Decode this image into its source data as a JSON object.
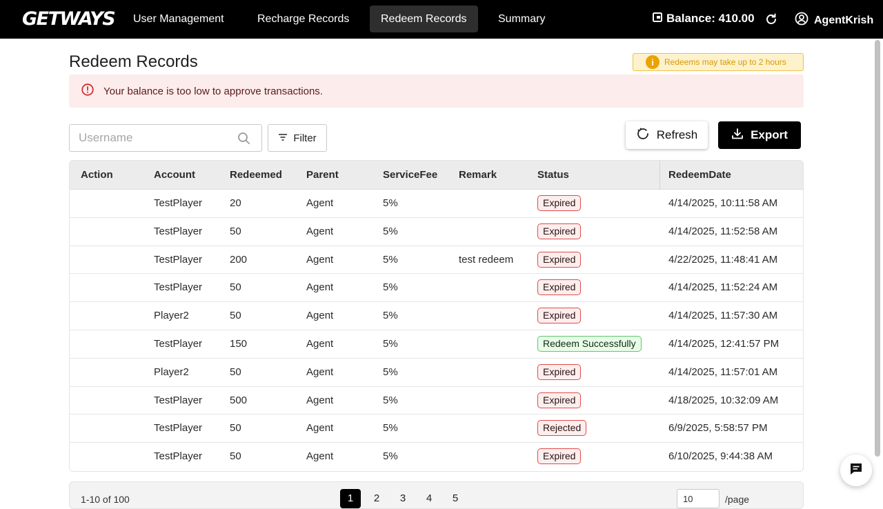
{
  "nav": {
    "logo": "GETWAYS",
    "items": [
      {
        "label": "User Management"
      },
      {
        "label": "Recharge Records"
      },
      {
        "label": "Redeem Records",
        "active": true
      },
      {
        "label": "Summary"
      }
    ],
    "balance": "Balance: 410.00",
    "username": "AgentKrish"
  },
  "page": {
    "title": "Redeem Records",
    "notice": "Redeems may take up to 2 hours",
    "notice_icon": "i",
    "alert": "Your balance is too low to approve transactions."
  },
  "toolbar": {
    "search_placeholder": "Username",
    "filter_label": "Filter",
    "refresh_label": "Refresh",
    "export_label": "Export"
  },
  "table": {
    "headers": {
      "action": "Action",
      "account": "Account",
      "redeemed": "Redeemed",
      "parent": "Parent",
      "servicefee": "ServiceFee",
      "remark": "Remark",
      "status": "Status",
      "redeemdate": "RedeemDate"
    },
    "rows": [
      {
        "account": "TestPlayer",
        "redeemed": "20",
        "parent": "Agent",
        "fee": "5%",
        "remark": "",
        "status": "Expired",
        "status_type": "red",
        "date": "4/14/2025, 10:11:58 AM"
      },
      {
        "account": "TestPlayer",
        "redeemed": "50",
        "parent": "Agent",
        "fee": "5%",
        "remark": "",
        "status": "Expired",
        "status_type": "red",
        "date": "4/14/2025, 11:52:58 AM"
      },
      {
        "account": "TestPlayer",
        "redeemed": "200",
        "parent": "Agent",
        "fee": "5%",
        "remark": "test redeem",
        "status": "Expired",
        "status_type": "red",
        "date": "4/22/2025, 11:48:41 AM"
      },
      {
        "account": "TestPlayer",
        "redeemed": "50",
        "parent": "Agent",
        "fee": "5%",
        "remark": "",
        "status": "Expired",
        "status_type": "red",
        "date": "4/14/2025, 11:52:24 AM"
      },
      {
        "account": "Player2",
        "redeemed": "50",
        "parent": "Agent",
        "fee": "5%",
        "remark": "",
        "status": "Expired",
        "status_type": "red",
        "date": "4/14/2025, 11:57:30 AM"
      },
      {
        "account": "TestPlayer",
        "redeemed": "150",
        "parent": "Agent",
        "fee": "5%",
        "remark": "",
        "status": "Redeem Successfully",
        "status_type": "green",
        "date": "4/14/2025, 12:41:57 PM"
      },
      {
        "account": "Player2",
        "redeemed": "50",
        "parent": "Agent",
        "fee": "5%",
        "remark": "",
        "status": "Expired",
        "status_type": "red",
        "date": "4/14/2025, 11:57:01 AM"
      },
      {
        "account": "TestPlayer",
        "redeemed": "500",
        "parent": "Agent",
        "fee": "5%",
        "remark": "",
        "status": "Expired",
        "status_type": "red",
        "date": "4/18/2025, 10:32:09 AM"
      },
      {
        "account": "TestPlayer",
        "redeemed": "50",
        "parent": "Agent",
        "fee": "5%",
        "remark": "",
        "status": "Rejected",
        "status_type": "red",
        "date": "6/9/2025, 5:58:57 PM"
      },
      {
        "account": "TestPlayer",
        "redeemed": "50",
        "parent": "Agent",
        "fee": "5%",
        "remark": "",
        "status": "Expired",
        "status_type": "red",
        "date": "6/10/2025, 9:44:38 AM"
      }
    ]
  },
  "pagination": {
    "range": "1-10 of 100",
    "pages": [
      "1",
      "2",
      "3",
      "4",
      "5"
    ],
    "current": "1",
    "page_size": "10",
    "per_page_label": "/page"
  },
  "colors": {
    "nav_bg": "#000000",
    "alert_bg": "#fdecec",
    "alert_icon": "#d32f2f",
    "notice_bg": "#fdf2cc",
    "notice_text": "#d59a00",
    "badge_red": "#e04a4a",
    "badge_green": "#5ec86a"
  },
  "icons": {
    "wallet": "wallet-icon",
    "reload": "reload-icon",
    "user": "user-circle-icon",
    "alert": "error-circle-icon",
    "search": "search-icon",
    "filter": "filter-icon",
    "refresh": "refresh-icon",
    "export": "download-icon",
    "chat": "chat-icon"
  }
}
